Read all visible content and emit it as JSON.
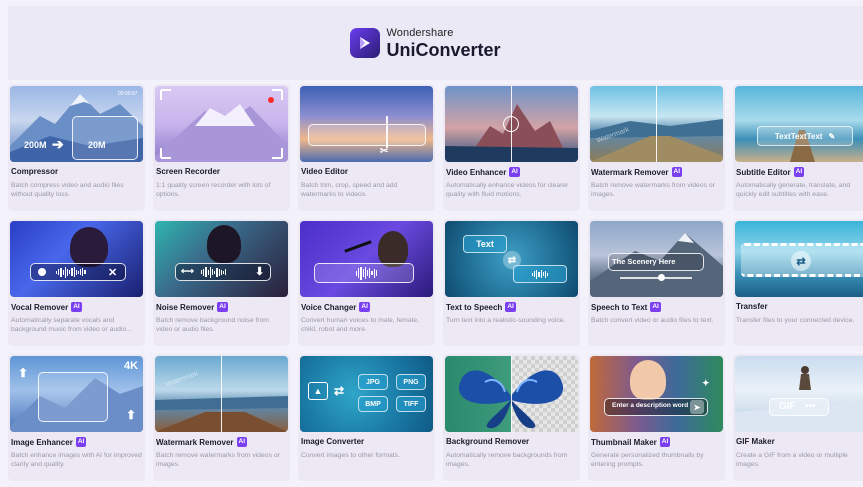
{
  "header": {
    "brand_top": "Wondershare",
    "brand_main": "UniConverter"
  },
  "ai_badge": "AI",
  "cards": [
    {
      "title": "Compressor",
      "ai": false,
      "desc": "Batch compress video and audio files without quality loss.",
      "overlay": [
        "200M",
        "20M",
        "00:00:07"
      ]
    },
    {
      "title": "Screen Recorder",
      "ai": false,
      "desc": "1:1 quality screen recorder with lots of options."
    },
    {
      "title": "Video Editor",
      "ai": false,
      "desc": "Batch trim, crop, speed and add watermarks to videos."
    },
    {
      "title": "Video Enhancer",
      "ai": true,
      "desc": "Automatically enhance videos for clearer quality with fluid motions."
    },
    {
      "title": "Watermark Remover",
      "ai": true,
      "desc": "Batch remove watermarks from videos or images.",
      "overlay": [
        "Watermark"
      ]
    },
    {
      "title": "Subtitle Editor",
      "ai": true,
      "desc": "Automatically generate, translate, and quickly edit subtitles with ease.",
      "overlay": [
        "TextTextText"
      ]
    },
    {
      "title": "Vocal Remover",
      "ai": true,
      "desc": "Automatically separate vocals and background music from video or audio..."
    },
    {
      "title": "Noise Remover",
      "ai": true,
      "desc": "Batch remove background noise from video or audio files."
    },
    {
      "title": "Voice Changer",
      "ai": true,
      "desc": "Convert human voices to male, female, child, robot and more."
    },
    {
      "title": "Text to Speech",
      "ai": true,
      "desc": "Turn text into a realistic-sounding voice.",
      "overlay": [
        "Text"
      ]
    },
    {
      "title": "Speech to Text",
      "ai": true,
      "desc": "Batch convert video or audio files to text.",
      "overlay": [
        "The Scenery Here"
      ]
    },
    {
      "title": "Transfer",
      "ai": false,
      "desc": "Transfer files to your connected device."
    },
    {
      "title": "Image Enhancer",
      "ai": true,
      "desc": "Batch enhance images with AI for improved clarity and quality.",
      "overlay": [
        "4K"
      ]
    },
    {
      "title": "Watermark Remover",
      "ai": true,
      "desc": "Batch remove watermarks from videos or images.",
      "overlay": [
        "Watermark"
      ]
    },
    {
      "title": "Image Converter",
      "ai": false,
      "desc": "Convert images to other formats.",
      "overlay": [
        "JPG",
        "PNG",
        "BMP",
        "TIFF"
      ]
    },
    {
      "title": "Background Remover",
      "ai": false,
      "desc": "Automatically remove backgrounds from images."
    },
    {
      "title": "Thumbnail Maker",
      "ai": true,
      "desc": "Generate personalized thumbnails by entering prompts.",
      "overlay": [
        "Enter a description word"
      ]
    },
    {
      "title": "GIF Maker",
      "ai": false,
      "desc": "Create a GIF from a video or multiple images.",
      "overlay": [
        "GIF"
      ]
    }
  ]
}
